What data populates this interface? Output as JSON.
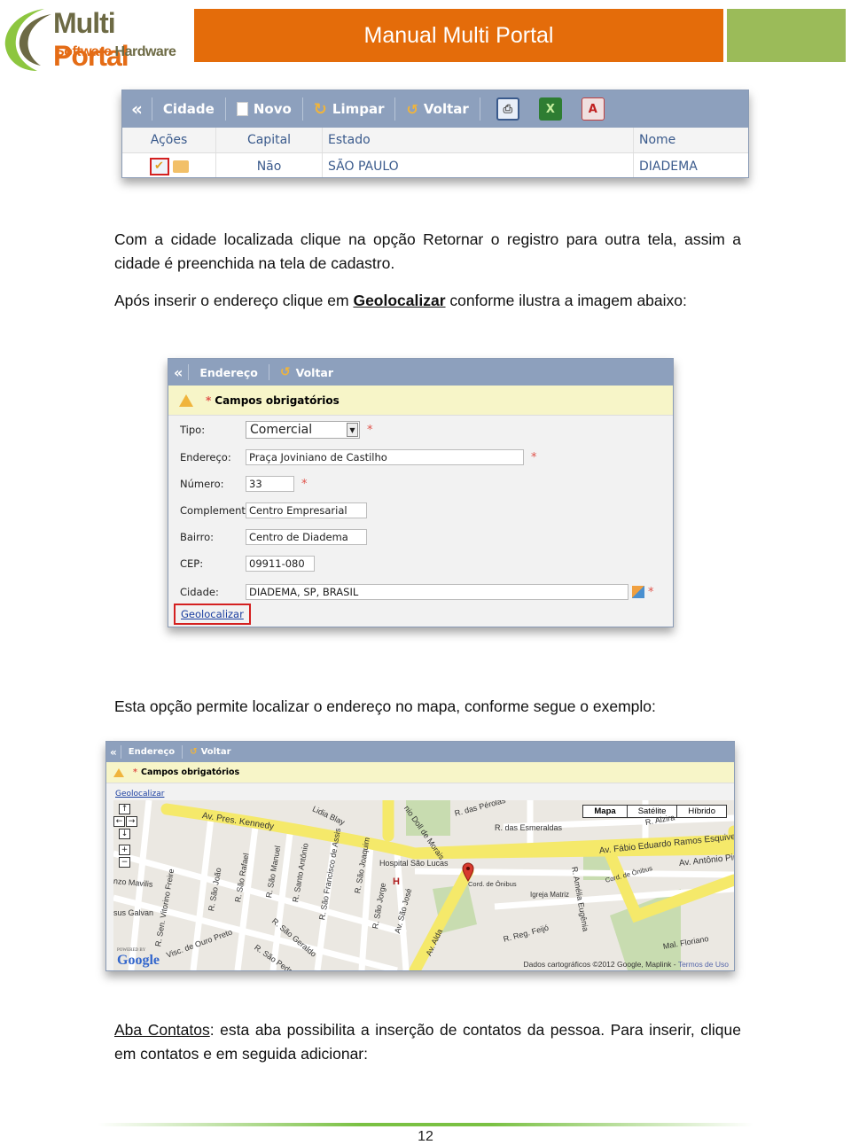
{
  "header": {
    "logo_line1_a": "Multi",
    "logo_line1_b": "Portal",
    "logo_line2_a": "Software",
    "logo_line2_b": "Hardware",
    "title": "Manual Multi Portal",
    "colors": {
      "orange": "#e46c0a",
      "green": "#9bbb59"
    }
  },
  "cidade_panel": {
    "toolbar": {
      "collapse": "«",
      "title": "Cidade",
      "novo": "Novo",
      "limpar": "Limpar",
      "voltar": "Voltar",
      "icons": [
        "print-icon",
        "excel-icon",
        "pdf-icon"
      ]
    },
    "columns": [
      "Ações",
      "Capital",
      "Estado",
      "Nome"
    ],
    "rows": [
      {
        "capital": "Não",
        "estado": "SÃO PAULO",
        "nome": "DIADEMA"
      }
    ]
  },
  "paragraphs": {
    "p1": "Com a cidade localizada clique na opção Retornar o registro para outra tela, assim a cidade é preenchida na tela de cadastro.",
    "p2_before": "Após inserir o endereço clique em ",
    "p2_link": "Geolocalizar",
    "p2_after": " conforme ilustra a imagem abaixo:",
    "p3": "Esta opção permite localizar o endereço no mapa, conforme segue o exemplo:",
    "p4_link": "Aba Contatos",
    "p4_after": ": esta aba possibilita a inserção de contatos da pessoa. Para inserir, clique em contatos e em seguida adicionar:"
  },
  "endereco_form": {
    "toolbar": {
      "collapse": "«",
      "title": "Endereço",
      "voltar": "Voltar"
    },
    "warning": "Campos obrigatórios",
    "required_mark": "*",
    "fields": {
      "tipo_label": "Tipo:",
      "tipo_value": "Comercial",
      "endereco_label": "Endereço:",
      "endereco_value": "Praça Joviniano de Castilho",
      "numero_label": "Número:",
      "numero_value": "33",
      "complemento_label": "Complemento:",
      "complemento_value": "Centro Empresarial",
      "bairro_label": "Bairro:",
      "bairro_value": "Centro de Diadema",
      "cep_label": "CEP:",
      "cep_value": "09911-080",
      "cidade_label": "Cidade:",
      "cidade_value": "DIADEMA, SP, BRASIL"
    },
    "geolocalizar": "Geolocalizar"
  },
  "map_panel": {
    "toolbar": {
      "collapse": "«",
      "title": "Endereço",
      "voltar": "Voltar"
    },
    "warning": "Campos obrigatórios",
    "geolocalizar": "Geolocalizar",
    "map_types": [
      "Mapa",
      "Satélite",
      "Híbrido"
    ],
    "active_type": "Mapa",
    "controls": {
      "up": "↑",
      "left": "←",
      "right": "→",
      "down": "↓",
      "zoom_in": "+",
      "zoom_out": "−"
    },
    "street_labels": {
      "kennedy": "Av. Pres. Kennedy",
      "esquivel": "Av. Fábio Eduardo Ramos Esquivel",
      "pirajussara": "Av. Antônio Piran",
      "esmeraldas": "R. das Esmeraldas",
      "perolas": "R. das Pérolas",
      "alzira": "R. Alzira",
      "amelia": "R. Amélia Eugênia",
      "aida": "Av. Alda",
      "feijo": "R. Reg. Feijó",
      "hospital": "Hospital São Lucas",
      "igreja": "Igreja Matriz",
      "onibus": "Cord. de Ônibus",
      "sao_joao": "R. São João",
      "sao_rafael": "R. São Rafael",
      "sao_manuel": "R. São Manuel",
      "santo_antonio": "R. Santo Antônio",
      "sao_francisco": "R. São Francisco de Assis",
      "sao_joaquim": "R. São Joaquim",
      "sao_jorge": "R. São Jorge",
      "sao_jose": "Av. São José",
      "vitorino": "R. Sen. Vitorino Freire",
      "ouro_preto": "Visc. de Ouro Preto",
      "sao_pedro": "R. São Pedro",
      "sao_gerardo": "R. São Geraldo",
      "galvan": "sus Galvan",
      "mavilis": "nzo Mavilis",
      "floriano": "Mal. Floriano",
      "lidia": "Lidia Blay",
      "doll": "nio Doll de Morais"
    },
    "powered_by": "POWERED BY",
    "google": "Google",
    "attribution": "Dados cartográficos ©2012 Google, Maplink - ",
    "terms": "Termos de Uso"
  },
  "footer": {
    "page_number": "12"
  }
}
